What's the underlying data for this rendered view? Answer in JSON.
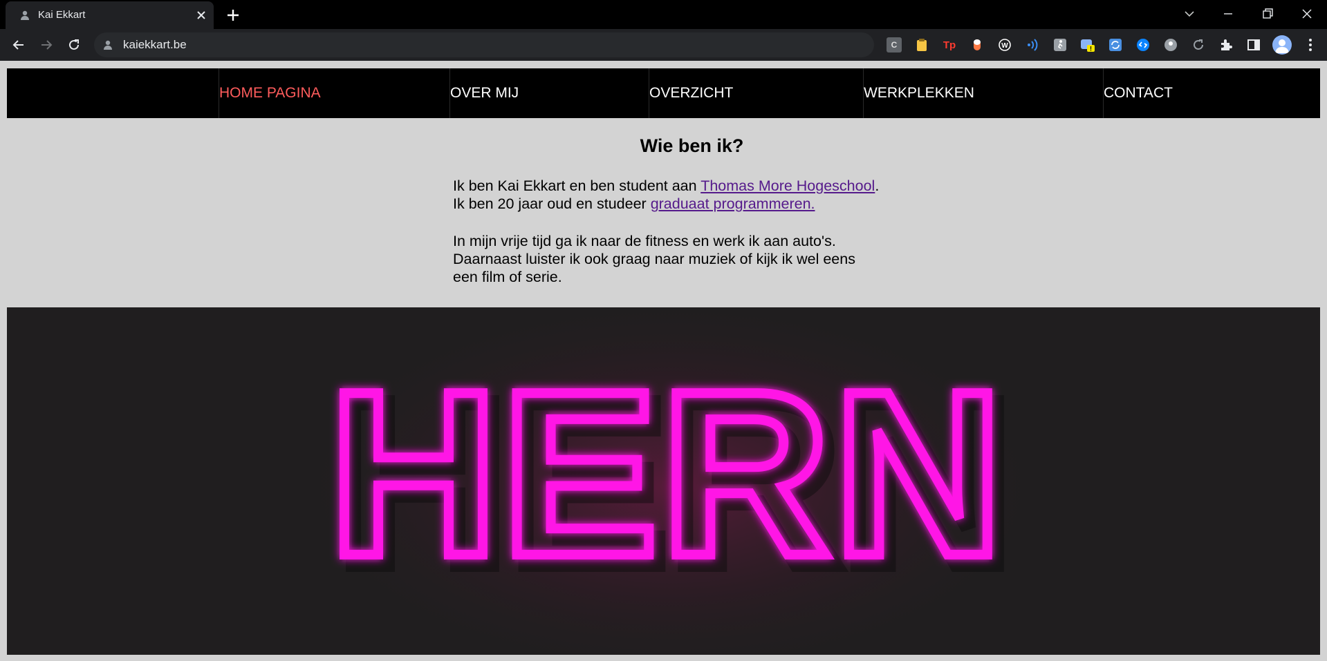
{
  "browser": {
    "tab_title": "Kai Ekkart",
    "url": "kaiekkart.be",
    "extensions": [
      "C",
      "clipboard",
      "Tp",
      "pill",
      "W",
      "wifi",
      "walker",
      "badge-app",
      "sync",
      "shazam",
      "circle",
      "loop",
      "puzzle",
      "sidepanel"
    ],
    "extension_badge": "!"
  },
  "nav": {
    "items": [
      {
        "label": "HOME PAGINA",
        "active": true
      },
      {
        "label": "OVER MIJ",
        "active": false
      },
      {
        "label": "OVERZICHT",
        "active": false
      },
      {
        "label": "WERKPLEKKEN",
        "active": false
      },
      {
        "label": "CONTACT",
        "active": false
      }
    ]
  },
  "main": {
    "heading": "Wie ben ik?",
    "p1_part1": "Ik ben Kai Ekkart en ben student aan ",
    "p1_link1": "Thomas More Hogeschool",
    "p1_part2": ". Ik ben 20 jaar oud en studeer ",
    "p1_link2": "graduaat programmeren.",
    "p2": "In mijn vrije tijd ga ik naar de fitness en werk ik aan auto's. Daarnaast luister ik ook graag naar muziek of kijk ik wel eens een film of serie."
  },
  "hero": {
    "neon_text": "HERN",
    "neon_color": "#ff19e6",
    "background": "#201e1f"
  },
  "colors": {
    "nav_active": "#ff5c5c",
    "link": "#551a8b",
    "page_bg": "#d3d3d3"
  }
}
